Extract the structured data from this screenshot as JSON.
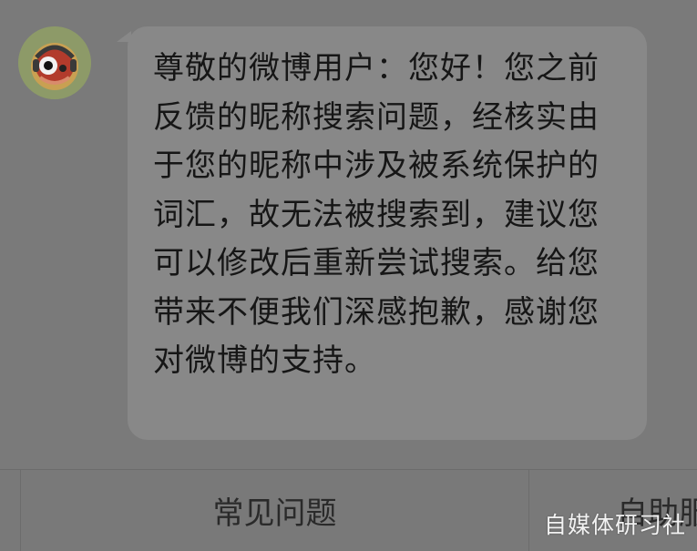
{
  "chat": {
    "agent_avatar_icon": "weibo-assistant-avatar-icon",
    "message": "尊敬的微博用户：您好！您之前反馈的昵称搜索问题，经核实由于您的昵称中涉及被系统保护的词汇，故无法被搜索到，建议您可以修改后重新尝试搜索。给您带来不便我们深感抱歉，感谢您对微博的支持。"
  },
  "bottom_menu": {
    "faq_label": "常见问题",
    "self_service_label": "自助服"
  },
  "watermark": "自媒体研习社",
  "colors": {
    "background": "#7a7a7a",
    "bubble": "#888888",
    "text": "#161616"
  }
}
